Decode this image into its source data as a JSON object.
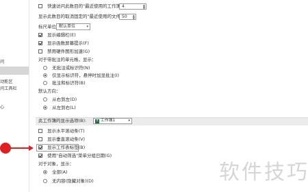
{
  "nav": {
    "items": [
      "",
      "",
      "",
      "",
      "",
      "",
      "",
      "",
      "",
      "",
      "",
      "",
      ""
    ],
    "partial_items": [
      "",
      "",
      "",
      "",
      "",
      ""
    ]
  },
  "nav_visible": [
    "",
    "",
    "",
    "",
    "",
    ""
  ],
  "nav_labels": {
    "item_a": "",
    "item_b": "",
    "item_c": "",
    "item_d": "",
    "item_e": "",
    "item_f": ""
  },
  "nav_text": [
    "",
    "",
    "",
    "",
    "",
    "",
    "",
    "",
    ""
  ],
  "left_nav": [
    {
      "label": "",
      "selected": false
    },
    {
      "label": "问",
      "selected": false
    },
    {
      "label": "",
      "selected": true
    },
    {
      "label": "动能区",
      "selected": false
    },
    {
      "label": "问工具栏",
      "selected": false
    },
    {
      "label": "心",
      "selected": false
    }
  ],
  "options": {
    "quick_access_label": "快速访问此数目的\"最近使用的工作簿\"(Q):",
    "quick_access_value": "4",
    "recent_unpinned_label": "显示此数目的取消固定的\"最近使用的文件夹\"(F):",
    "recent_unpinned_value": "50",
    "ruler_units_label": "标尺单位(U)",
    "ruler_units_value": "默认单位",
    "show_formula_bar": "显示编辑栏(E)",
    "show_function_tooltips": "显示函数屏幕提示(F)",
    "disable_hw_accel": "禁用硬件图形加速(G)",
    "comments_heading": "对于带批注的单元格，显示：",
    "comments_none": "无批注或标识符(N)",
    "comments_indicator": "仅显示标识符，悬停时加显批注(I)",
    "comments_both": "批注和标识符(B)",
    "direction_heading": "默认方向：",
    "direction_rtl": "从右到左(D)",
    "direction_ltr": "从左到右(L)"
  },
  "workbook_section": {
    "heading": "此工作簿的显示选项(B):",
    "workbook_name": "工作簿1",
    "show_hscroll": "显示水平滚动条(T)",
    "show_vscroll": "显示垂直滚动条(V)",
    "show_sheet_tabs": "显示工作表标签(B)",
    "group_dates": "使用\"自动筛选\"菜单分组日期(G)",
    "objects_heading": "对于对象，显示：",
    "objects_all": "全部(A)",
    "objects_none": "无内容(隐藏对象)(D)"
  },
  "watermark": "软件技巧",
  "colors": {
    "marker": "#e02020",
    "excel_icon": "#1e7145",
    "selected_nav": "#d6d6d6"
  },
  "icons": {
    "excel": "excel-workbook-icon"
  }
}
